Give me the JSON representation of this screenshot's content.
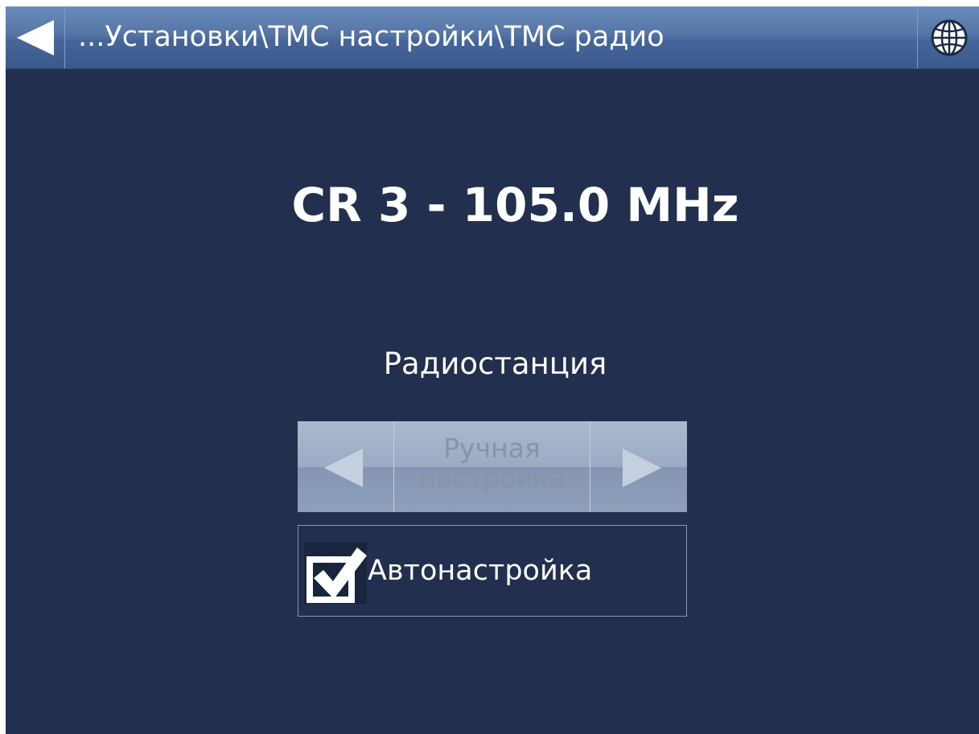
{
  "header": {
    "title": "...Установки\\ТМС настройки\\ТМС радио",
    "back_icon": "back-arrow-icon",
    "globe_icon": "globe-icon"
  },
  "station": {
    "current": "CR 3 - 105.0 MHz"
  },
  "radio_station": {
    "label": "Радиостанция",
    "selector": {
      "value": "Ручная настройка",
      "enabled": false,
      "prev_icon": "arrow-left-icon",
      "next_icon": "arrow-right-icon"
    }
  },
  "auto_tune": {
    "label": "Автонастройка",
    "checked": true,
    "icon": "checkbox-checked-icon"
  },
  "colors": {
    "background": "#222f4e",
    "header": "#5475a5",
    "text": "#ffffff",
    "disabled_text": "#8794a8"
  }
}
